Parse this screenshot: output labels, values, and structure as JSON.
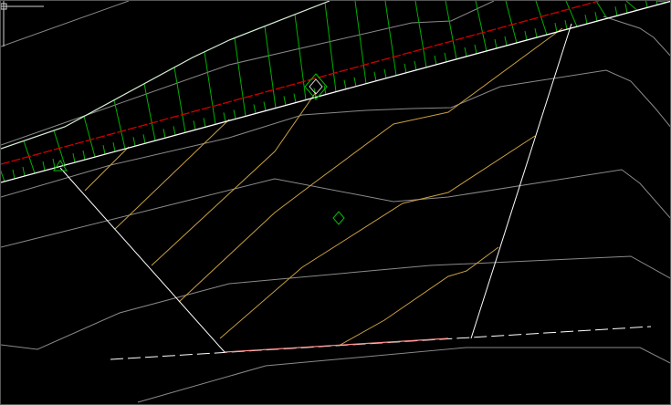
{
  "viewport": {
    "name": "cad-model-space",
    "background": "#000000"
  },
  "colors": {
    "hatch": "#00b000",
    "centerline": "#d00000",
    "boundary": "#ffffff",
    "contour": "#8a8a8a",
    "contour_major": "#c8a040",
    "marker": "#00c000"
  },
  "cursor": {
    "type": "crosshair"
  }
}
